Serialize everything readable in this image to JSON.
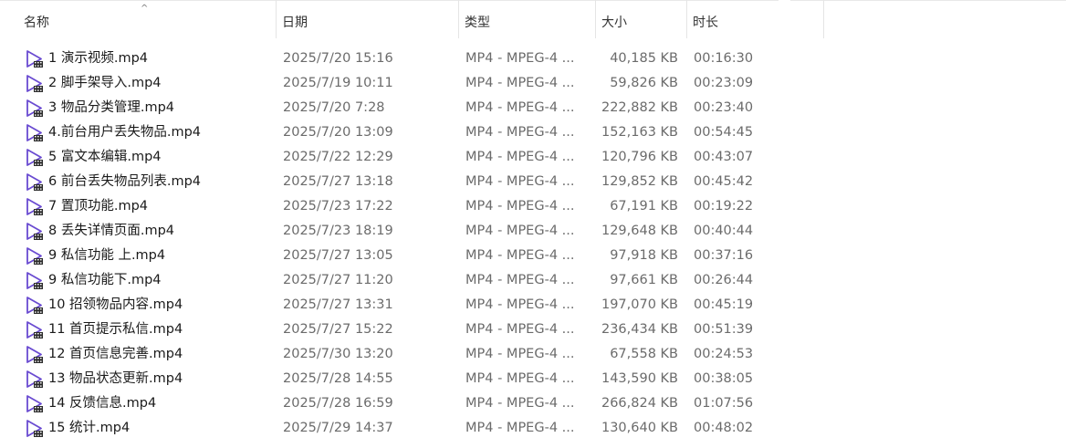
{
  "columns": {
    "name": "名称",
    "date": "日期",
    "type": "类型",
    "size": "大小",
    "duration": "时长"
  },
  "sort_indicator": "^",
  "icon": "video-file-icon",
  "colors": {
    "icon_accent": "#6a4bd1",
    "row_hover": "#e5f1fb"
  },
  "files": [
    {
      "name": "1 演示视频.mp4",
      "date": "2025/7/20 15:16",
      "type": "MP4 - MPEG-4 ...",
      "size": "40,185 KB",
      "duration": "00:16:30"
    },
    {
      "name": "2 脚手架导入.mp4",
      "date": "2025/7/19 10:11",
      "type": "MP4 - MPEG-4 ...",
      "size": "59,826 KB",
      "duration": "00:23:09"
    },
    {
      "name": "3 物品分类管理.mp4",
      "date": "2025/7/20 7:28",
      "type": "MP4 - MPEG-4 ...",
      "size": "222,882 KB",
      "duration": "00:23:40"
    },
    {
      "name": "4.前台用户丢失物品.mp4",
      "date": "2025/7/20 13:09",
      "type": "MP4 - MPEG-4 ...",
      "size": "152,163 KB",
      "duration": "00:54:45"
    },
    {
      "name": "5 富文本编辑.mp4",
      "date": "2025/7/22 12:29",
      "type": "MP4 - MPEG-4 ...",
      "size": "120,796 KB",
      "duration": "00:43:07"
    },
    {
      "name": "6 前台丢失物品列表.mp4",
      "date": "2025/7/27 13:18",
      "type": "MP4 - MPEG-4 ...",
      "size": "129,852 KB",
      "duration": "00:45:42"
    },
    {
      "name": "7 置顶功能.mp4",
      "date": "2025/7/23 17:22",
      "type": "MP4 - MPEG-4 ...",
      "size": "67,191 KB",
      "duration": "00:19:22"
    },
    {
      "name": "8 丢失详情页面.mp4",
      "date": "2025/7/23 18:19",
      "type": "MP4 - MPEG-4 ...",
      "size": "129,648 KB",
      "duration": "00:40:44"
    },
    {
      "name": "9 私信功能 上.mp4",
      "date": "2025/7/27 13:05",
      "type": "MP4 - MPEG-4 ...",
      "size": "97,918 KB",
      "duration": "00:37:16"
    },
    {
      "name": "9 私信功能下.mp4",
      "date": "2025/7/27 11:20",
      "type": "MP4 - MPEG-4 ...",
      "size": "97,661 KB",
      "duration": "00:26:44"
    },
    {
      "name": "10 招领物品内容.mp4",
      "date": "2025/7/27 13:31",
      "type": "MP4 - MPEG-4 ...",
      "size": "197,070 KB",
      "duration": "00:45:19"
    },
    {
      "name": "11 首页提示私信.mp4",
      "date": "2025/7/27 15:22",
      "type": "MP4 - MPEG-4 ...",
      "size": "236,434 KB",
      "duration": "00:51:39"
    },
    {
      "name": "12 首页信息完善.mp4",
      "date": "2025/7/30 13:20",
      "type": "MP4 - MPEG-4 ...",
      "size": "67,558 KB",
      "duration": "00:24:53"
    },
    {
      "name": "13 物品状态更新.mp4",
      "date": "2025/7/28 14:55",
      "type": "MP4 - MPEG-4 ...",
      "size": "143,590 KB",
      "duration": "00:38:05"
    },
    {
      "name": "14 反馈信息.mp4",
      "date": "2025/7/28 16:59",
      "type": "MP4 - MPEG-4 ...",
      "size": "266,824 KB",
      "duration": "01:07:56"
    },
    {
      "name": "15 统计.mp4",
      "date": "2025/7/29 14:37",
      "type": "MP4 - MPEG-4 ...",
      "size": "130,640 KB",
      "duration": "00:48:02"
    }
  ]
}
